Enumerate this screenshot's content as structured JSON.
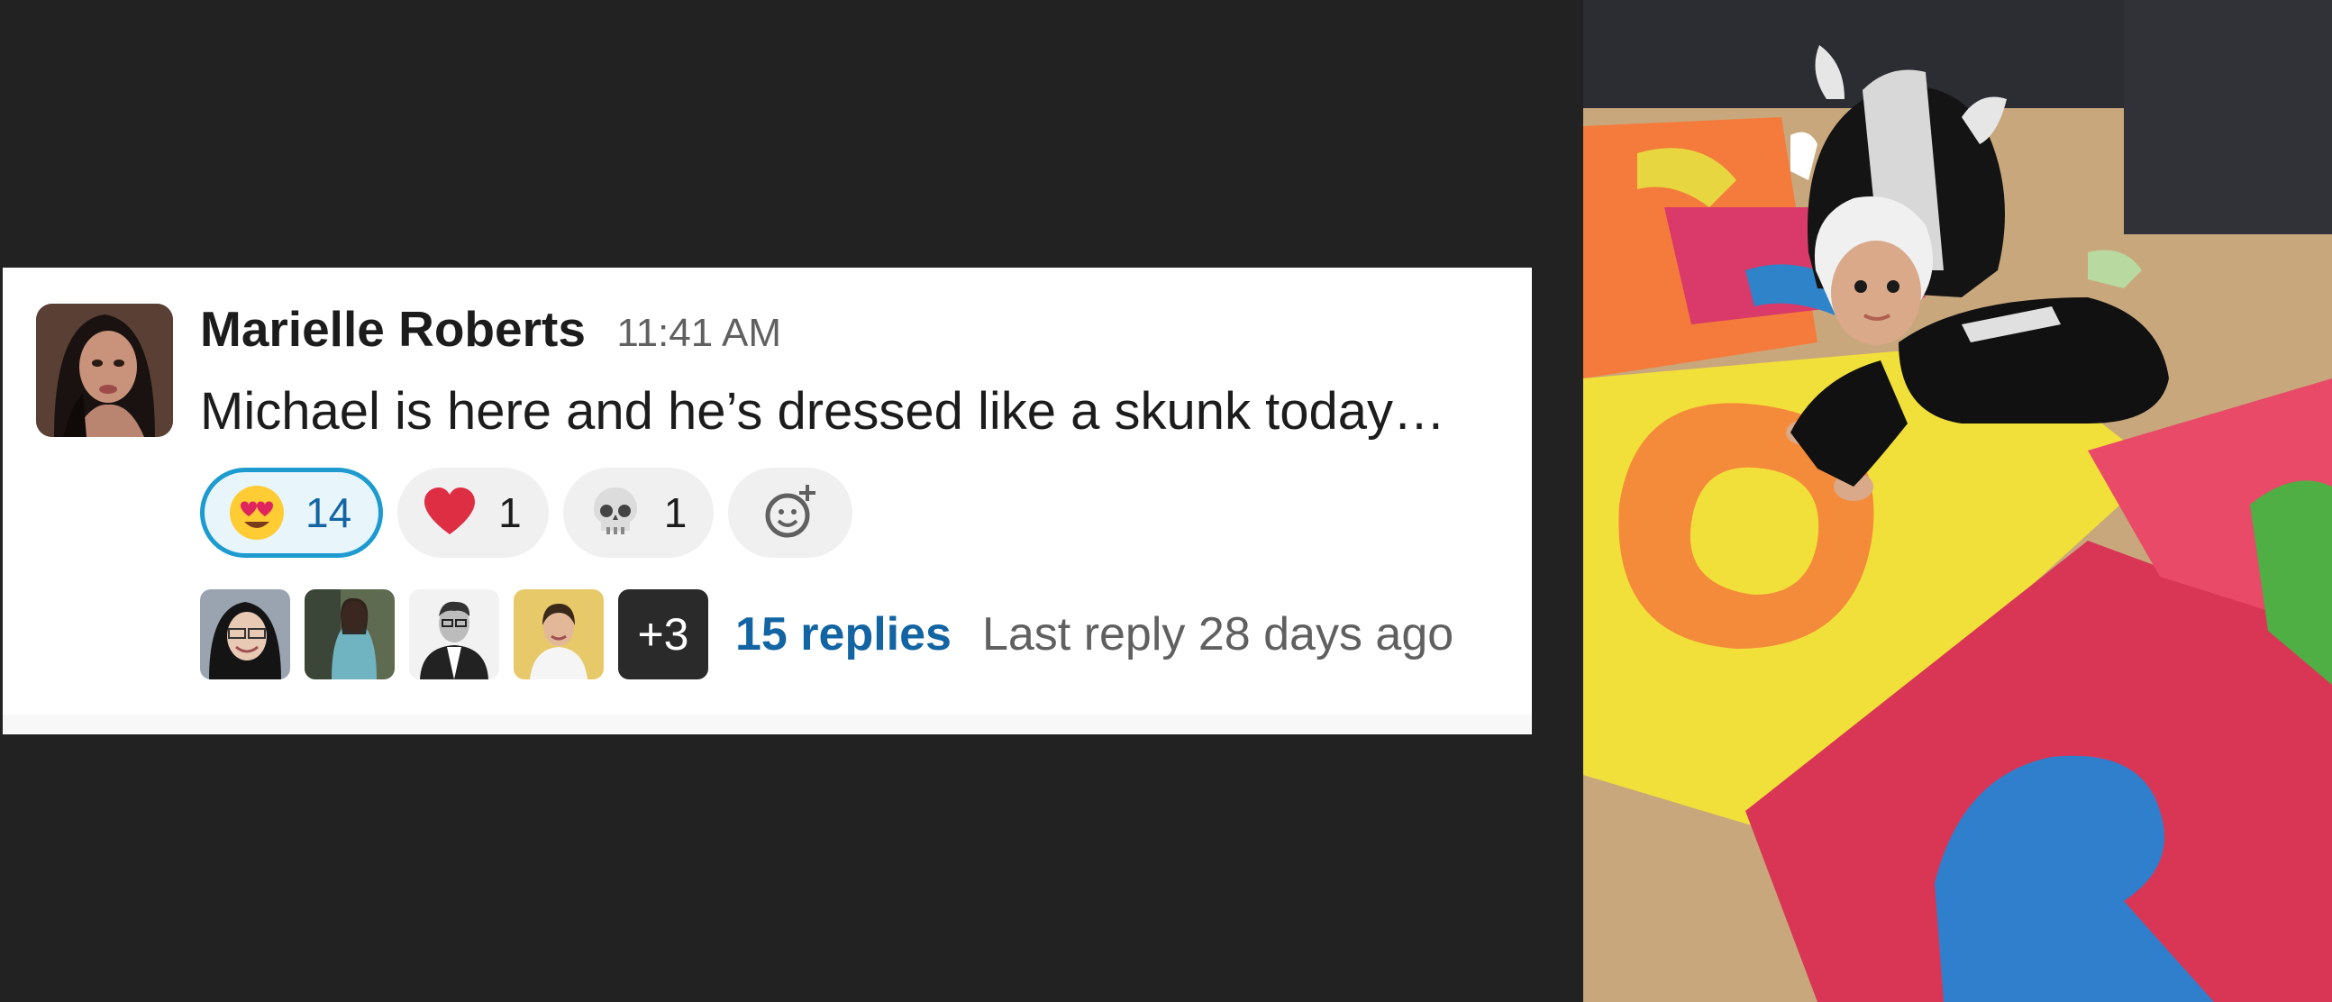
{
  "message": {
    "author": "Marielle Roberts",
    "time": "11:41 AM",
    "text": "Michael is here and he’s dressed like a skunk today…"
  },
  "reactions": [
    {
      "emoji": "heart-eyes-emoji",
      "count": "14",
      "active": true
    },
    {
      "emoji": "red-heart-emoji",
      "count": "1",
      "active": false
    },
    {
      "emoji": "skull-emoji",
      "count": "1",
      "active": false
    }
  ],
  "add_reaction_icon": "add-reaction-icon",
  "thread": {
    "participant_avatars": [
      "avatar-woman-glasses",
      "avatar-woman-outdoors",
      "avatar-man-suit",
      "avatar-woman-yellow"
    ],
    "more_count": "+3",
    "replies_label": "15 replies",
    "last_reply": "Last reply 28 days ago"
  },
  "colors": {
    "background": "#222222",
    "card": "#ffffff",
    "link": "#1264a3",
    "active_reaction_border": "#1d9bd1",
    "active_reaction_bg": "#e8f5fa"
  }
}
